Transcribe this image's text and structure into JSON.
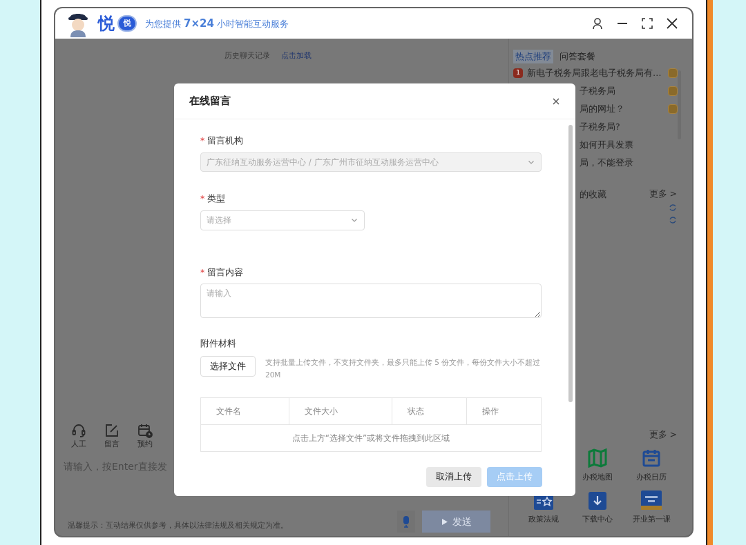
{
  "header": {
    "logo_text": "悦",
    "badge_text": "悦",
    "slogan": "为您提供 **7×24** 小时智能互动服务"
  },
  "chat": {
    "history_label": "历史聊天记录",
    "load_link": "点击加载",
    "tools": [
      {
        "kind": "headset",
        "label": "人工"
      },
      {
        "kind": "edit",
        "label": "留言"
      },
      {
        "kind": "calendar",
        "label": "预约"
      }
    ],
    "input_placeholder": "请输入，按Enter直接发",
    "send_label": "发送",
    "tip": "温馨提示：互动结果仅供参考，具体以法律法规及相关规定为准。"
  },
  "side": {
    "tabs": [
      {
        "label": "热点推荐",
        "selected": true
      },
      {
        "label": "问答套餐",
        "selected": false
      }
    ],
    "hot_items": [
      {
        "rank": "1",
        "text": "新电子税务局跟老电子税务局有…",
        "tagged": true
      },
      {
        "text": "子税务局",
        "tagged": true
      },
      {
        "text": "局的网址？",
        "tagged": true
      },
      {
        "text": "子税务局?",
        "tagged": false
      },
      {
        "text": "如何开具发票",
        "tagged": false
      },
      {
        "text": "局，不能登录",
        "tagged": false
      }
    ],
    "collection": {
      "title": "的收藏",
      "more": "更多 >"
    },
    "services_more": "更多 >",
    "services": [
      {
        "kind": "map",
        "label": "办税地图"
      },
      {
        "kind": "calendar",
        "label": "办税日历"
      },
      {
        "kind": "policy",
        "label": "政策法规"
      },
      {
        "kind": "download",
        "label": "下载中心"
      },
      {
        "kind": "course",
        "label": "开业第一课"
      }
    ]
  },
  "dialog": {
    "title": "在线留言",
    "org": {
      "label": "留言机构",
      "required": "*",
      "value": "广东征纳互动服务运营中心 / 广东广州市征纳互动服务运营中心",
      "disabled": true
    },
    "type": {
      "label": "类型",
      "required": "*",
      "placeholder": "请选择"
    },
    "content": {
      "label": "留言内容",
      "required": "*",
      "placeholder": "请输入"
    },
    "attach": {
      "label": "附件材料",
      "button": "选择文件",
      "hint": "支持批量上传文件，不支持文件夹，最多只能上传 5 份文件，每份文件大小不超过 20M"
    },
    "table": {
      "columns": [
        "文件名",
        "文件大小",
        "状态",
        "操作"
      ],
      "empty": "点击上方“选择文件”或将文件拖拽到此区域"
    },
    "buttons": [
      {
        "label": "取消上传",
        "kind": "secondary",
        "disabled": false
      },
      {
        "label": "点击上传",
        "kind": "primary",
        "disabled": true
      }
    ]
  }
}
